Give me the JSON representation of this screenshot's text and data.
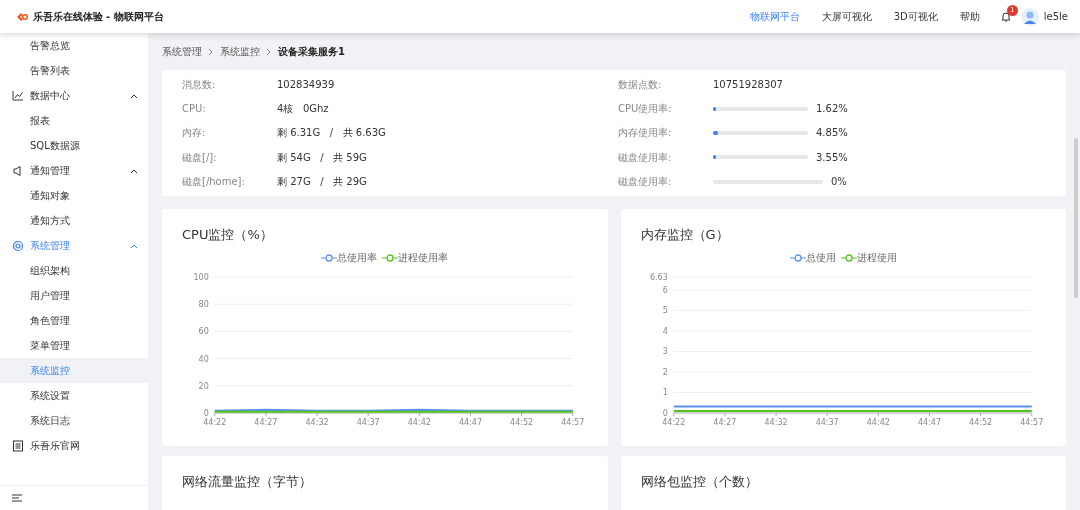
{
  "header": {
    "title": "乐吾乐在线体验 - 物联网平台",
    "nav": [
      {
        "label": "物联网平台",
        "selected": true
      },
      {
        "label": "大屏可视化",
        "selected": false
      },
      {
        "label": "3D可视化",
        "selected": false
      },
      {
        "label": "帮助",
        "selected": false
      }
    ],
    "notification_badge": "1",
    "user": "le5le"
  },
  "sidebar": {
    "items": [
      {
        "children": [
          {
            "label": "告警总览",
            "selected": false
          },
          {
            "label": "告警列表",
            "selected": false
          }
        ]
      },
      {
        "label": "数据中心",
        "expanded": true,
        "selected": false,
        "children": [
          {
            "label": "报表",
            "selected": false
          },
          {
            "label": "SQL数据源",
            "selected": false
          }
        ]
      },
      {
        "label": "通知管理",
        "expanded": true,
        "selected": false,
        "children": [
          {
            "label": "通知对象",
            "selected": false
          },
          {
            "label": "通知方式",
            "selected": false
          }
        ]
      },
      {
        "label": "系统管理",
        "expanded": true,
        "selected": true,
        "children": [
          {
            "label": "组织架构",
            "selected": false
          },
          {
            "label": "用户管理",
            "selected": false
          },
          {
            "label": "角色管理",
            "selected": false
          },
          {
            "label": "菜单管理",
            "selected": false
          },
          {
            "label": "系统监控",
            "selected": true
          },
          {
            "label": "系统设置",
            "selected": false
          },
          {
            "label": "系统日志",
            "selected": false
          }
        ]
      },
      {
        "label": "乐吾乐官网",
        "selected": false
      }
    ]
  },
  "breadcrumb": [
    "系统管理",
    "系统监控",
    "设备采集服务1"
  ],
  "info": {
    "left": [
      {
        "label": "消息数:",
        "value": "102834939"
      },
      {
        "label": "CPU:",
        "value": "4核   0Ghz"
      },
      {
        "label": "内存:",
        "value": "剩 6.31G   /   共 6.63G"
      },
      {
        "label": "磁盘[/]:",
        "value": "剩 54G   /   共 59G"
      },
      {
        "label": "磁盘[/home]:",
        "value": "剩 27G   /   共 29G"
      }
    ],
    "right": [
      {
        "label": "数据点数:",
        "kind": "text",
        "value": "10751928307"
      },
      {
        "label": "CPU使用率:",
        "kind": "meter",
        "level": 0.0162,
        "reading": "1.62%"
      },
      {
        "label": "内存使用率:",
        "kind": "meter",
        "level": 0.0485,
        "reading": "4.85%"
      },
      {
        "label": "磁盘使用率:",
        "kind": "meter",
        "level": 0.0355,
        "reading": "3.55%"
      },
      {
        "label": "磁盘使用率:",
        "kind": "meter",
        "level": 0,
        "reading": "0%"
      }
    ]
  },
  "charts": [
    {
      "title": "CPU监控（%）",
      "chart_data": {
        "type": "line",
        "categories": [
          "44:22",
          "44:27",
          "44:32",
          "44:37",
          "44:42",
          "44:47",
          "44:52",
          "44:57"
        ],
        "ylim": [
          0,
          100
        ],
        "grid": true,
        "yticks": [
          0,
          20,
          40,
          60,
          80,
          100
        ],
        "series": [
          {
            "name": "总使用率",
            "color": "#5b8ff9",
            "values": [
              1.6,
              2.4,
              1.6,
              1.6,
              2.4,
              1.6,
              1.6,
              1.6
            ]
          },
          {
            "name": "进程使用率",
            "color": "#52c41a",
            "values": [
              1,
              1,
              1,
              1,
              1,
              1,
              1,
              1
            ]
          }
        ]
      }
    },
    {
      "title": "内存监控（G）",
      "chart_data": {
        "type": "line",
        "categories": [
          "44:22",
          "44:27",
          "44:32",
          "44:37",
          "44:42",
          "44:47",
          "44:52",
          "44:57"
        ],
        "ylim": [
          0,
          6.63
        ],
        "grid": true,
        "yticks": [
          0,
          1,
          2,
          3,
          4,
          5,
          6,
          {
            "value": 6.63,
            "label": "6.63"
          }
        ],
        "series": [
          {
            "name": "总使用",
            "color": "#5b8ff9",
            "values": [
              0.32,
              0.32,
              0.32,
              0.32,
              0.32,
              0.32,
              0.32,
              0.32
            ]
          },
          {
            "name": "进程使用",
            "color": "#52c41a",
            "values": [
              0.1,
              0.1,
              0.1,
              0.1,
              0.1,
              0.1,
              0.1,
              0.1
            ]
          }
        ]
      }
    },
    {
      "title": "网络流量监控（字节）"
    },
    {
      "title": "网络包监控（个数）"
    }
  ]
}
